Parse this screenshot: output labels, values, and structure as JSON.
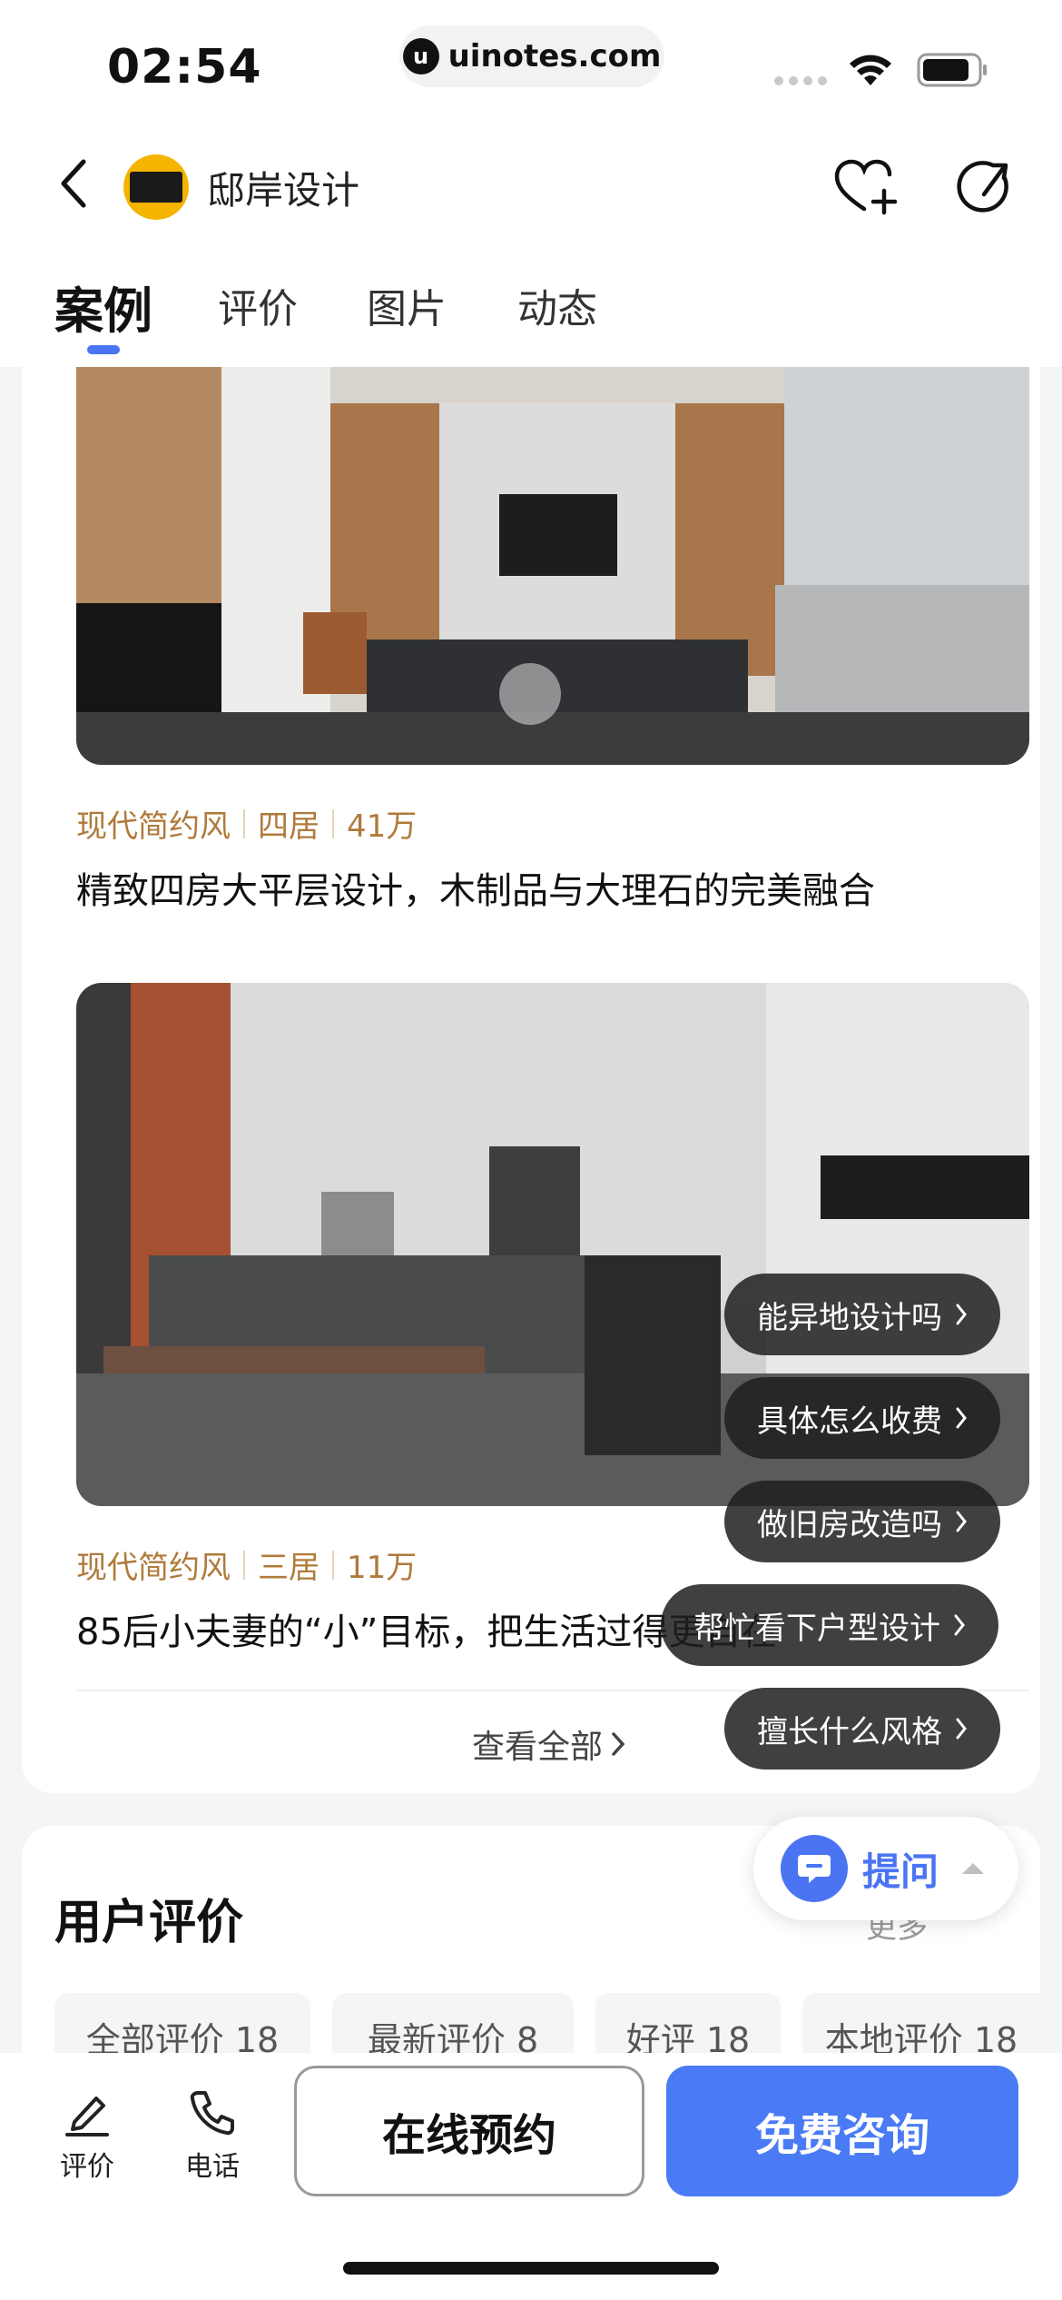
{
  "status_bar": {
    "time": "02:54",
    "url": "uinotes.com",
    "url_logo_letter": "u"
  },
  "header": {
    "shop_name": "邸岸设计"
  },
  "tabs": [
    {
      "label": "案例",
      "active": true
    },
    {
      "label": "评价",
      "active": false
    },
    {
      "label": "图片",
      "active": false
    },
    {
      "label": "动态",
      "active": false
    }
  ],
  "cases": [
    {
      "tags": [
        "现代简约风",
        "四居",
        "41万"
      ],
      "title": "精致四房大平层设计，木制品与大理石的完美融合"
    },
    {
      "tags": [
        "现代简约风",
        "三居",
        "11万"
      ],
      "title": "85后小夫妻的“小”目标，把生活过得更自在"
    }
  ],
  "view_all": "查看全部",
  "quick_questions": [
    "能异地设计吗",
    "具体怎么收费",
    "做旧房改造吗",
    "帮忙看下户型设计",
    "擅长什么风格"
  ],
  "ask": {
    "label": "提问"
  },
  "reviews": {
    "title": "用户评价",
    "more": "更多",
    "filters": [
      "全部评价 18",
      "最新评价 8",
      "好评 18",
      "本地评价 18"
    ]
  },
  "bottom_bar": {
    "review_label": "评价",
    "phone_label": "电话",
    "book_label": "在线预约",
    "consult_label": "免费咨询"
  },
  "colors": {
    "accent": "#4a7bf5",
    "tag": "#b07a3b"
  }
}
